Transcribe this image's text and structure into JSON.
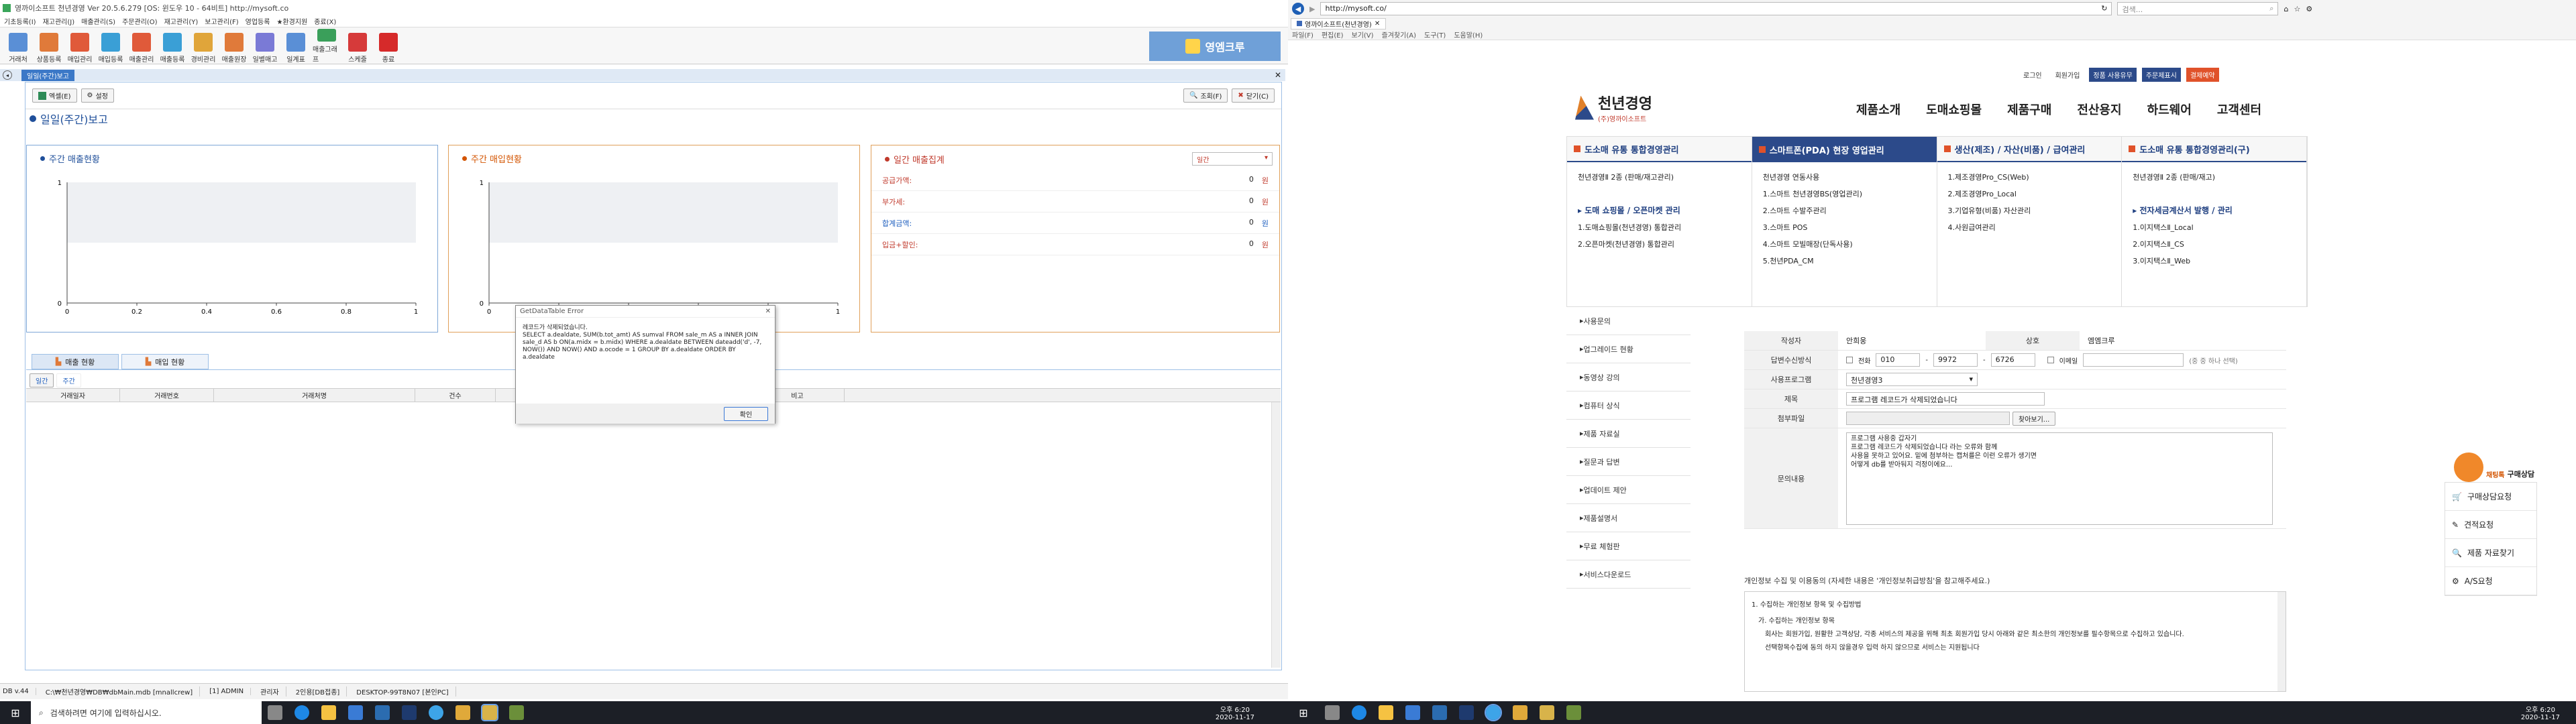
{
  "left": {
    "titlebar": {
      "title": "영까이소프트 천년경영 Ver 20.5.6.279  [OS: 윈도우 10 - 64비트]  http://mysoft.co"
    },
    "menu": [
      "기초등록(I)",
      "재고관리(J)",
      "매출관리(S)",
      "주문관리(O)",
      "재고관리(Y)",
      "보고관리(F)",
      "영업등록",
      "★환경지원",
      "종료(X)"
    ],
    "toolbar": [
      {
        "label": "거래처",
        "color": "#5a8fd6"
      },
      {
        "label": "상품등록",
        "color": "#e07a3a"
      },
      {
        "label": "매입관리",
        "color": "#e05a3a"
      },
      {
        "label": "매입등록",
        "color": "#3a9fd6"
      },
      {
        "label": "매출관리",
        "color": "#e05a3a"
      },
      {
        "label": "매출등록",
        "color": "#3a9fd6"
      },
      {
        "label": "경비관리",
        "color": "#e0a53a"
      },
      {
        "label": "매출원장",
        "color": "#e07a3a"
      },
      {
        "label": "일별매고",
        "color": "#7a7ad6"
      },
      {
        "label": "일계표",
        "color": "#5a8fd6"
      },
      {
        "label": "매출그래프",
        "color": "#3a9f5a"
      },
      {
        "label": "스케줄",
        "color": "#d63a3a"
      },
      {
        "label": "종료",
        "color": "#d62a2a"
      }
    ],
    "brand_tab": "영엠크루",
    "doc_tab": "일일(주간)보고",
    "buttons": {
      "excel": "엑셀(E)",
      "settings": "설정",
      "search": "조회(F)",
      "close": "닫기(C)"
    },
    "page_title": "일일(주간)보고",
    "cards": {
      "weekly_sales": "주간 매출현황",
      "weekly_purchase": "주간 매입현황",
      "summary": "일간 매출집계"
    },
    "chart_data": [
      {
        "type": "line",
        "title": "주간 매출현황",
        "xlabel": "",
        "ylabel": "",
        "ylim": [
          0,
          1
        ],
        "xlim": [
          0,
          1
        ],
        "x_ticks": [
          "0",
          "0.2",
          "0.4",
          "0.6",
          "0.8",
          "1"
        ],
        "y_ticks": [
          "0",
          "1"
        ],
        "series": []
      },
      {
        "type": "line",
        "title": "주간 매입현황",
        "xlabel": "",
        "ylabel": "",
        "ylim": [
          0,
          1
        ],
        "xlim": [
          0,
          1
        ],
        "x_ticks": [
          "0",
          "0.2",
          "0.4",
          "0.6",
          "0.8",
          "1"
        ],
        "y_ticks": [
          "0",
          "1"
        ],
        "series": []
      }
    ],
    "summary_select": "일간",
    "summary_rows": [
      {
        "label": "공급가액:",
        "value": "0",
        "unit": "원",
        "color": "#c0392b"
      },
      {
        "label": "부가세:",
        "value": "0",
        "unit": "원",
        "color": "#c0392b"
      },
      {
        "label": "합계금액:",
        "value": "0",
        "unit": "원",
        "color": "#1f5fbf"
      },
      {
        "label": "입금+할인:",
        "value": "0",
        "unit": "원",
        "color": "#c0392b"
      }
    ],
    "bottom_tabs": [
      "매출 현황",
      "매입 현황"
    ],
    "sub_tabs": [
      "일간",
      "주간"
    ],
    "grid_headers": [
      "거래일자",
      "거래번호",
      "거래처명",
      "건수",
      "",
      "비고"
    ],
    "dialog": {
      "title": "GetDataTable Error",
      "message": "레코드가 삭제되었습니다.\nSELECT a.dealdate, SUM(b.tot_amt) AS sumval FROM sale_m AS a INNER JOIN sale_d AS b ON(a.midx = b.midx) WHERE a.dealdate BETWEEN dateadd('d', -7, NOW()) AND NOW() AND a.ocode = 1 GROUP BY a.dealdate ORDER BY a.dealdate",
      "ok": "확인"
    },
    "statusbar": [
      "DB v.44",
      "C:\\₩천년경영₩DB₩dbMain.mdb [mnallcrew]",
      "[1] ADMIN",
      "관리자",
      "2인용[DB접종]",
      "DESKTOP-99T8N07 [본인PC]"
    ],
    "taskbar": {
      "search_placeholder": "검색하려면 여기에 입력하십시오.",
      "time": "오후 6:20",
      "date": "2020-11-17"
    }
  },
  "right": {
    "browser": {
      "url": "http://mysoft.co/",
      "tab_title": "영까이소프트(천년경영)",
      "search_placeholder": "검색...",
      "menu": [
        "파일(F)",
        "편집(E)",
        "보기(V)",
        "즐겨찾기(A)",
        "도구(T)",
        "도움말(H)"
      ]
    },
    "topnav": [
      "로그인",
      "회원가입",
      "정품 사용유무",
      "주문제표시",
      "결제예약"
    ],
    "logo": {
      "name": "천년경영",
      "sub": "(주)영까이소프트"
    },
    "mainnav": [
      "제품소개",
      "도매쇼핑몰",
      "제품구매",
      "전산용지",
      "하드웨어",
      "고객센터"
    ],
    "categories": [
      {
        "title": "도소매 유통 통합경영관리",
        "items": [
          "천년경영Ⅱ 2종 (판매/재고관리)",
          "",
          "▸ 도매 쇼핑몰 / 오픈마켓 관리",
          "1.도매쇼핑몰(천년경영) 통합관리",
          "2.오픈마켓(천년경영) 통합관리"
        ]
      },
      {
        "title": "스마트폰(PDA) 현장 영업관리",
        "items": [
          "천년경영 연동사용",
          "1.스마트 천년경영BS(영업관리)",
          "2.스마트 수발주관리",
          "3.스마트 POS",
          "4.스마트 모빌매장(단독사용)",
          "5.천년PDA_CM"
        ]
      },
      {
        "title": "생산(제조) / 자산(비품) / 급여관리",
        "items": [
          "1.제조경영Pro_CS(Web)",
          "2.제조경영Pro_Local",
          "3.기업유형(비품) 자산관리",
          "4.사원급여관리"
        ]
      },
      {
        "title": "도소매 유통 통합경영관리(구)",
        "items": [
          "천년경영Ⅱ 2종 (판매/재고)",
          "",
          "▸ 전자세금계산서 발행 / 관리",
          "1.이지택스Ⅱ_Local",
          "2.이지택스Ⅱ_CS",
          "3.이지택스Ⅱ_Web"
        ]
      }
    ],
    "sidebar": [
      "사용문의",
      "업그레이드 현황",
      "동영상 강의",
      "컴퓨터 상식",
      "제품 자료실",
      "질문과 답변",
      "업데이트 제안",
      "제품설명서",
      "무료 체험판",
      "서비스다운로드"
    ],
    "form": {
      "author_label": "작성자",
      "author": "안희웅",
      "company_label": "상호",
      "company": "엠엠크루",
      "phone_label": "답변수신방식",
      "phone_opt": "전화",
      "phone1": "010",
      "phone2": "9972",
      "phone3": "6726",
      "email_opt": "이메일",
      "email_note": "(중 중 하나 선택)",
      "program_label": "사용프로그램",
      "program": "천년경영3",
      "subject_label": "제목",
      "subject": "프로그램 레코드가 삭제되었습니다",
      "file_label": "첨부파일",
      "file_btn": "찾아보기...",
      "content_label": "문의내용",
      "content": "프로그램 사용중 갑자기\n프로그램 레코드가 삭제되었습니다 라는 오류와 함께\n사용을 못하고 있어요. 밑에 첨부하는 캡처를은 이런 오류가 생기면\n어떻게 db를 받아둬지 걱정이에요..."
    },
    "privacy": {
      "title": "개인정보 수집 및 이용동의 (자세한 내용은 '개인정보취급방침'을 참고해주세요.)",
      "lines": [
        "1. 수집하는 개인정보 항목 및 수집방법",
        "가. 수집하는 개인정보 항목",
        "회사는 회원가입, 원활한 고객상담, 각종 서비스의 제공을 위해 최초 회원가입 당시 아래와 같은 최소한의 개인정보를 필수항목으로 수집하고 있습니다.",
        "선택항목수집에 동의 하지 않을경우 입력 하지 않으므로 서비스는 지원됩니다"
      ]
    },
    "consult": {
      "badge": "채팅톡",
      "title": "구매상담",
      "items": [
        "구매상담요청",
        "견적요청",
        "제품 자료찾기",
        "A/S요청"
      ]
    },
    "taskbar": {
      "time": "오후 6:20",
      "date": "2020-11-17"
    }
  }
}
